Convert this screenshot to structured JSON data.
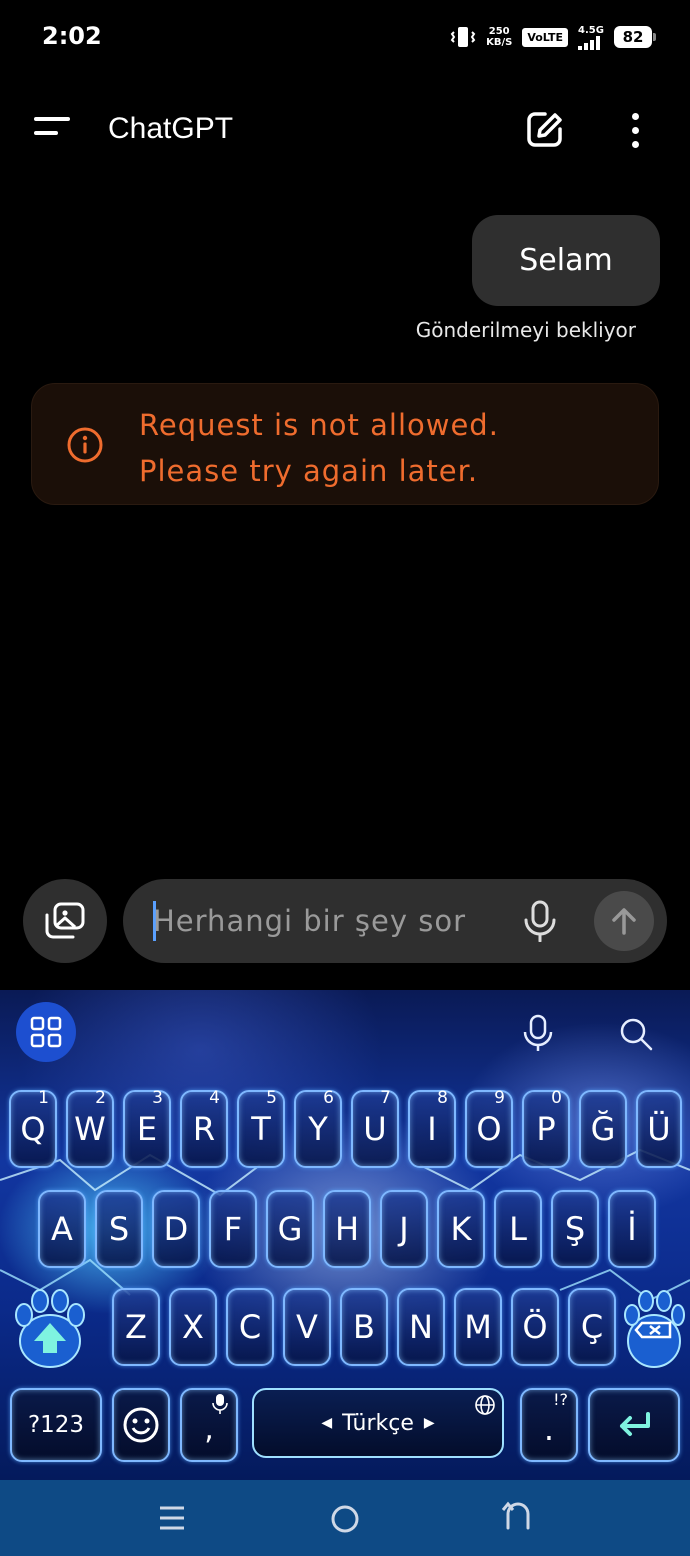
{
  "status_bar": {
    "time": "2:02",
    "net_speed_top": "250",
    "net_speed_bottom": "KB/S",
    "volte": "VoLTE",
    "network": "4.5G",
    "battery": "82"
  },
  "app_bar": {
    "title": "ChatGPT",
    "icons": [
      "menu-icon",
      "edit-icon",
      "more-vertical-icon"
    ]
  },
  "conversation": {
    "user_message": "Selam",
    "pending_status": "Gönderilmeyi bekliyor",
    "error_line1": "Request is not allowed.",
    "error_line2": "Please try again later.",
    "error_color": "#ef6c2e"
  },
  "composer": {
    "placeholder": "Herhangi bir şey sor",
    "value": ""
  },
  "keyboard": {
    "language": "Türkçe",
    "row1": [
      {
        "label": "Q",
        "hint": "1"
      },
      {
        "label": "W",
        "hint": "2"
      },
      {
        "label": "E",
        "hint": "3"
      },
      {
        "label": "R",
        "hint": "4"
      },
      {
        "label": "T",
        "hint": "5"
      },
      {
        "label": "Y",
        "hint": "6"
      },
      {
        "label": "U",
        "hint": "7"
      },
      {
        "label": "I",
        "hint": "8"
      },
      {
        "label": "O",
        "hint": "9"
      },
      {
        "label": "P",
        "hint": "0"
      },
      {
        "label": "Ğ",
        "hint": ""
      },
      {
        "label": "Ü",
        "hint": ""
      }
    ],
    "row2": [
      "A",
      "S",
      "D",
      "F",
      "G",
      "H",
      "J",
      "K",
      "L",
      "Ş",
      "İ"
    ],
    "row3": [
      "Z",
      "X",
      "C",
      "V",
      "B",
      "N",
      "M",
      "Ö",
      "Ç"
    ],
    "symbols_label": "?123",
    "comma_label": ",",
    "period_label": ".",
    "period_hint": "!?",
    "accent_color": "#7fb8ff"
  },
  "nav_bar": {
    "icons": [
      "recents-icon",
      "home-icon",
      "back-icon"
    ]
  }
}
